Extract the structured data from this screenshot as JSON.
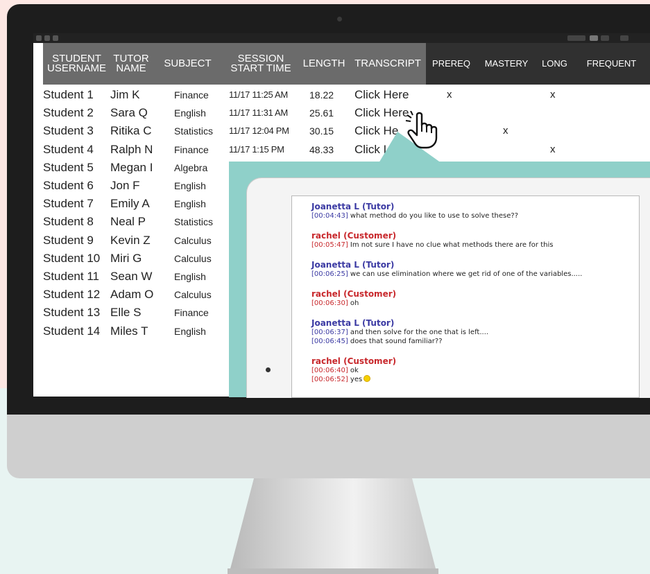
{
  "colors": {
    "backdrop_top": "#fde8e4",
    "backdrop_bottom": "#e8f4f2",
    "header_gray": "#6b6b6b",
    "header_black": "#303030",
    "popup_teal": "#8fd0c9",
    "tutor_color": "#3b3aa3",
    "customer_color": "#c8282c"
  },
  "table": {
    "headers": [
      "STUDENT\nUSERNAME",
      "TUTOR\nNAME",
      "SUBJECT",
      "SESSION\nSTART TIME",
      "LENGTH",
      "TRANSCRIPT",
      "PREREQ",
      "MASTERY",
      "LONG",
      "FREQUENT"
    ],
    "rows": [
      {
        "student": "Student 1",
        "tutor": "Jim K",
        "subject": "Finance",
        "start": "11/17 11:25 AM",
        "length": "18.22",
        "transcript": "Click Here",
        "prereq": "x",
        "mastery": "",
        "long": "x"
      },
      {
        "student": "Student 2",
        "tutor": "Sara Q",
        "subject": "English",
        "start": "11/17 11:31 AM",
        "length": "25.61",
        "transcript": "Click Here",
        "prereq": "",
        "mastery": "",
        "long": ""
      },
      {
        "student": "Student 3",
        "tutor": "Ritika C",
        "subject": "Statistics",
        "start": "11/17 12:04 PM",
        "length": "30.15",
        "transcript": "Click He",
        "prereq": "",
        "mastery": "x",
        "long": ""
      },
      {
        "student": "Student 4",
        "tutor": "Ralph N",
        "subject": "Finance",
        "start": "11/17 1:15 PM",
        "length": "48.33",
        "transcript": "Click I",
        "prereq": "",
        "mastery": "",
        "long": "x"
      },
      {
        "student": "Student 5",
        "tutor": "Megan I",
        "subject": "Algebra"
      },
      {
        "student": "Student 6",
        "tutor": "Jon F",
        "subject": "English"
      },
      {
        "student": "Student 7",
        "tutor": "Emily A",
        "subject": "English"
      },
      {
        "student": "Student 8",
        "tutor": "Neal P",
        "subject": "Statistics"
      },
      {
        "student": "Student 9",
        "tutor": "Kevin Z",
        "subject": "Calculus"
      },
      {
        "student": "Student 10",
        "tutor": "Miri G",
        "subject": "Calculus"
      },
      {
        "student": "Student 11",
        "tutor": "Sean W",
        "subject": "English"
      },
      {
        "student": "Student 12",
        "tutor": "Adam O",
        "subject": "Calculus"
      },
      {
        "student": "Student 13",
        "tutor": "Elle S",
        "subject": "Finance"
      },
      {
        "student": "Student 14",
        "tutor": "Miles T",
        "subject": "English"
      }
    ]
  },
  "transcript": [
    {
      "speaker": "Joanetta L (Tutor)",
      "role": "tutor",
      "lines": [
        {
          "ts": "[00:04:43]",
          "text": "what method do you like to use to solve these??"
        }
      ]
    },
    {
      "speaker": "rachel (Customer)",
      "role": "customer",
      "lines": [
        {
          "ts": "[00:05:47]",
          "text": "Im not sure I have no clue what methods there are for this"
        }
      ]
    },
    {
      "speaker": "Joanetta L (Tutor)",
      "role": "tutor",
      "lines": [
        {
          "ts": "[00:06:25]",
          "text": "we can use elimination where we get rid of one of the variables....."
        }
      ]
    },
    {
      "speaker": "rachel (Customer)",
      "role": "customer",
      "lines": [
        {
          "ts": "[00:06:30]",
          "text": "oh"
        }
      ]
    },
    {
      "speaker": "Joanetta L (Tutor)",
      "role": "tutor",
      "lines": [
        {
          "ts": "[00:06:37]",
          "text": "and then solve for the one that is left...."
        },
        {
          "ts": "[00:06:45]",
          "text": "does that sound familiar??"
        }
      ]
    },
    {
      "speaker": "rachel (Customer)",
      "role": "customer",
      "lines": [
        {
          "ts": "[00:06:40]",
          "text": "ok"
        },
        {
          "ts": "[00:06:52]",
          "text": "yes",
          "emoji": "smiley-icon"
        }
      ]
    }
  ],
  "cursor_icon": "hand-pointer-icon"
}
